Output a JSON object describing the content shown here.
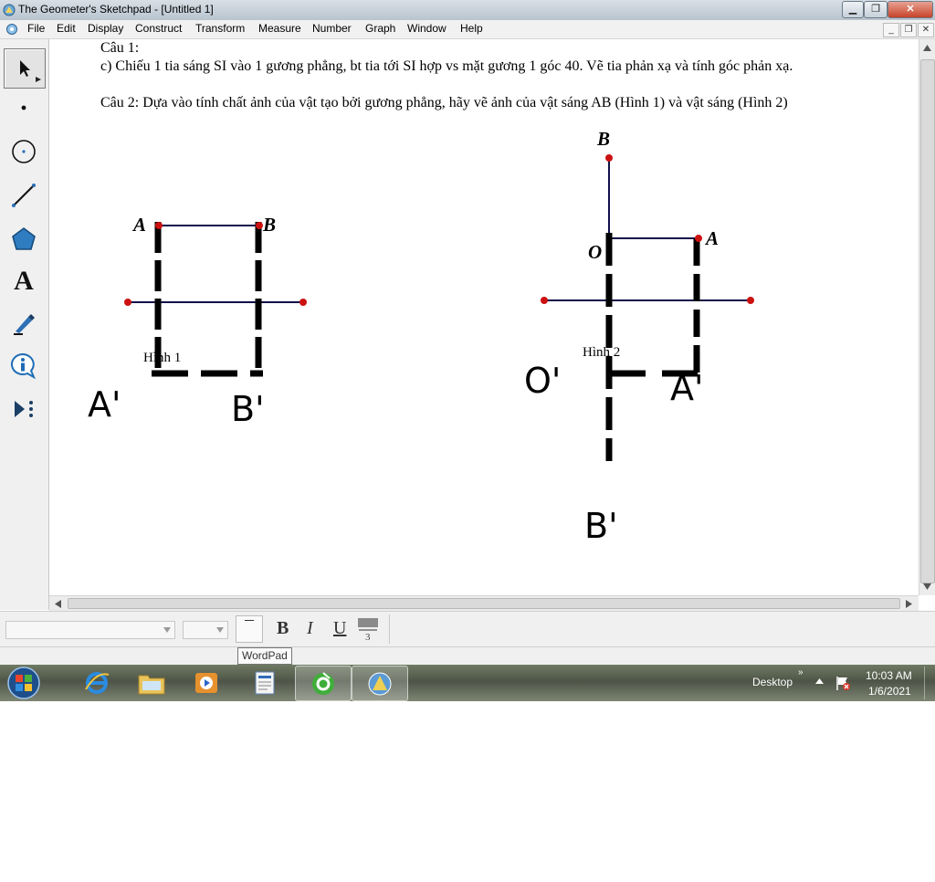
{
  "window": {
    "title": "The Geometer's Sketchpad - [Untitled 1]"
  },
  "menu": {
    "items": [
      "File",
      "Edit",
      "Display",
      "Construct",
      "Transform",
      "Measure",
      "Number",
      "Graph",
      "Window",
      "Help"
    ]
  },
  "toolbox": {
    "tools": [
      "arrow-select-tool",
      "point-tool",
      "compass-tool",
      "straightedge-tool",
      "polygon-tool",
      "text-tool",
      "marker-tool",
      "information-tool",
      "custom-tool"
    ],
    "text_tool_glyph": "A"
  },
  "canvas": {
    "cau1_heading": "Câu 1:",
    "cau1_text": "c) Chiếu 1 tia sáng SI vào 1 gương phẳng, bt tia tới SI hợp vs mặt gương 1 góc 40. Vẽ tia phản xạ và tính góc phản xạ.",
    "cau2_text": "Câu 2: Dựa vào tính chất ảnh của vật tạo bởi gương phẳng, hãy vẽ ảnh của vật sáng AB (Hình 1) và vật sáng (Hình 2)",
    "figure1": {
      "caption": "Hình 1",
      "label_a": "A",
      "label_b": "B",
      "image_a": "A'",
      "image_b": "B'"
    },
    "figure2": {
      "caption": "Hình 2",
      "label_b": "B",
      "label_o": "O",
      "label_a": "A",
      "image_o": "O'",
      "image_a": "A'",
      "image_b": "B'"
    }
  },
  "text_palette": {
    "bold": "B",
    "italic": "I",
    "underline": "U"
  },
  "tooltip": "WordPad",
  "taskbar": {
    "desktop_label": "Desktop",
    "time": "10:03 AM",
    "date": "1/6/2021"
  },
  "colors": {
    "point": "#cc1111",
    "segment": "#10104a",
    "mirror": "#000000"
  }
}
